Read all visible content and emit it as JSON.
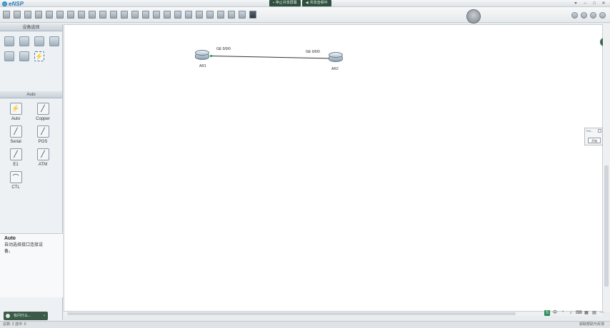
{
  "app": {
    "title": "eNSP"
  },
  "share_bar": {
    "stop_share": "停止共享屏幕",
    "mic": "共享音频中"
  },
  "window_controls": {
    "menu": "▾",
    "minimize": "–",
    "maximize": "□",
    "close": "✕"
  },
  "device_panel": {
    "title": "设备选择"
  },
  "cable_panel": {
    "title": "Auto",
    "cables": [
      {
        "label": "Auto",
        "icon": "lightning-icon"
      },
      {
        "label": "Copper",
        "icon": "copper-cable-icon"
      },
      {
        "label": "Serial",
        "icon": "serial-cable-icon"
      },
      {
        "label": "POS",
        "icon": "pos-cable-icon"
      },
      {
        "label": "E1",
        "icon": "e1-cable-icon"
      },
      {
        "label": "ATM",
        "icon": "atm-cable-icon"
      },
      {
        "label": "CTL",
        "icon": "ctl-cable-icon"
      }
    ]
  },
  "description": {
    "title": "Auto",
    "text": "自动选择接口连接设备。"
  },
  "chat_button": {
    "label": "有问什么..."
  },
  "topology": {
    "devices": [
      {
        "name": "AR1"
      },
      {
        "name": "AR2"
      }
    ],
    "link": {
      "port_a": "GE 0/0/0",
      "port_b": "GE 0/0/0"
    }
  },
  "float_widget": {
    "title": "Pol...",
    "button": "开始"
  },
  "statusbar": {
    "left": "总数: 2  选中: 0",
    "right": "获取帮助与反馈"
  },
  "colors": {
    "accent": "#3d6a52",
    "link": "#333333",
    "port_up": "#0a9f3a"
  }
}
